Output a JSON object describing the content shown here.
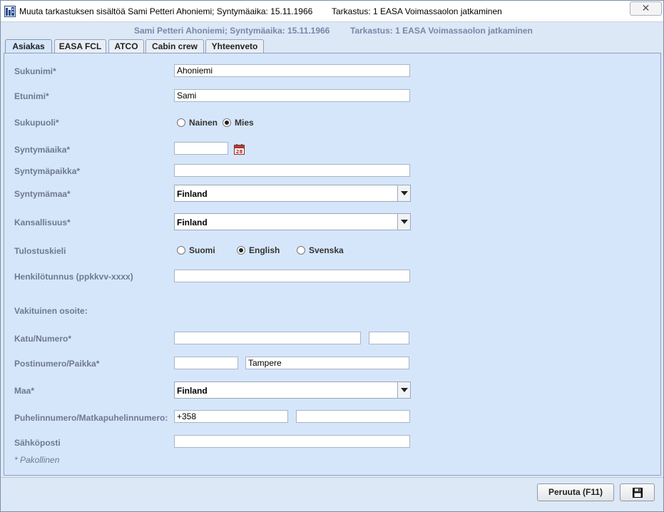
{
  "window": {
    "title_left": "Muuta tarkastuksen sisältöä Sami Petteri Ahoniemi; Syntymäaika: 15.11.1966",
    "title_right": "Tarkastus: 1 EASA Voimassaolon jatkaminen",
    "close_label": "✕"
  },
  "subheader": {
    "person": "Sami Petteri Ahoniemi; Syntymäaika: 15.11.1966",
    "inspection": "Tarkastus: 1 EASA Voimassaolon jatkaminen"
  },
  "tabs": [
    {
      "label": "Asiakas",
      "active": true
    },
    {
      "label": "EASA FCL",
      "active": false
    },
    {
      "label": "ATCO",
      "active": false
    },
    {
      "label": "Cabin crew",
      "active": false
    },
    {
      "label": "Yhteenveto",
      "active": false
    }
  ],
  "form": {
    "surname": {
      "label": "Sukunimi*",
      "value": "Ahoniemi"
    },
    "firstname": {
      "label": "Etunimi*",
      "value": "Sami"
    },
    "gender": {
      "label": "Sukupuoli*",
      "options": [
        "Nainen",
        "Mies"
      ],
      "selected": "Mies"
    },
    "birthdate": {
      "label": "Syntymäaika*",
      "value": "",
      "calendar_icon_text": "28"
    },
    "birthplace": {
      "label": "Syntymäpaikka*",
      "value": ""
    },
    "birthcountry": {
      "label": "Syntymämaa*",
      "value": "Finland"
    },
    "nationality": {
      "label": "Kansallisuus*",
      "value": "Finland"
    },
    "print_language": {
      "label": "Tulostuskieli",
      "options": [
        "Suomi",
        "English",
        "Svenska"
      ],
      "selected": "English"
    },
    "personal_id": {
      "label": "Henkilötunnus (ppkkvv-xxxx)",
      "value": ""
    },
    "address_heading": "Vakituinen osoite:",
    "street": {
      "label": "Katu/Numero*",
      "value": "",
      "number": ""
    },
    "postal": {
      "label": "Postinumero/Paikka*",
      "code": "",
      "city": "Tampere"
    },
    "country": {
      "label": "Maa*",
      "value": "Finland"
    },
    "phone": {
      "label": "Puhelinnumero/Matkapuhelinnumero:",
      "phone": "+358",
      "mobile": ""
    },
    "email": {
      "label": "Sähköposti",
      "value": ""
    },
    "required_note": "* Pakollinen"
  },
  "footer": {
    "cancel_label": "Peruuta (F11)"
  }
}
